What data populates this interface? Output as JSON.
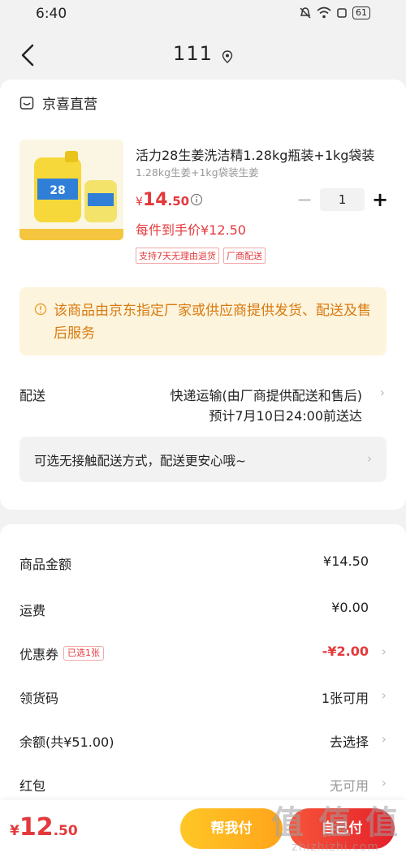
{
  "status_bar": {
    "time": "6:40",
    "battery": "61"
  },
  "header": {
    "title": "111"
  },
  "store": {
    "name": "京喜直营"
  },
  "product": {
    "name": "活力28生姜洗洁精1.28kg瓶装+1kg袋装",
    "spec": "1.28kg生姜+1kg袋装生姜",
    "price_symbol": "¥",
    "price_int": "14",
    "price_dec": ".50",
    "quantity": "1",
    "unit_price": "每件到手价¥12.50",
    "tags": [
      "支持7天无理由退货",
      "厂商配送"
    ]
  },
  "notice": {
    "text": "该商品由京东指定厂家或供应商提供发货、配送及售后服务"
  },
  "shipping": {
    "label": "配送",
    "method": "快递运输(由厂商提供配送和售后)",
    "eta": "预计7月10日24:00前送达",
    "contactless": "可选无接触配送方式，配送更安心哦~"
  },
  "summary": {
    "goods_label": "商品金额",
    "goods_value": "¥14.50",
    "freight_label": "运费",
    "freight_value": "¥0.00",
    "coupon_label": "优惠券",
    "coupon_badge": "已选1张",
    "coupon_value": "-¥2.00",
    "pickup_label": "领货码",
    "pickup_value": "1张可用",
    "balance_label": "余额(共¥51.00)",
    "balance_value": "去选择",
    "redpacket_label": "红包",
    "redpacket_value": "无可用"
  },
  "bottom": {
    "total_symbol": "¥",
    "total_int": "12",
    "total_dec": ".50",
    "help_pay": "帮我付",
    "self_pay": "自己付"
  },
  "watermark": {
    "logo": "值 值 值",
    "url": "zhizhizhi.com"
  },
  "colors": {
    "accent_red": "#e4393c",
    "notice_orange": "#d97a10",
    "help_yellow": "#ffb320"
  }
}
